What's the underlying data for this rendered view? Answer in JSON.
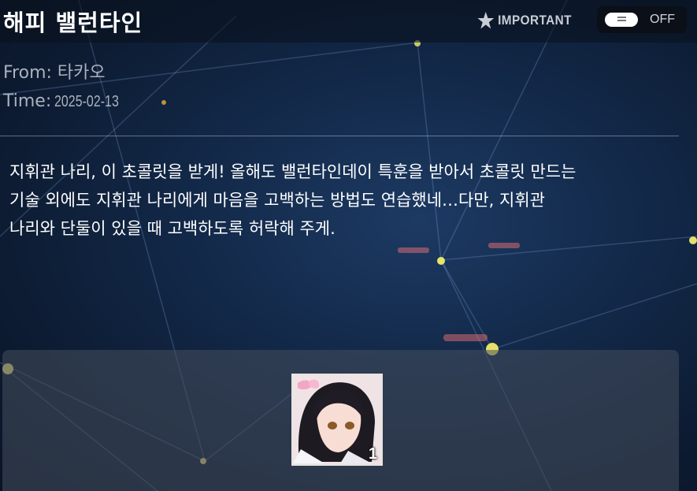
{
  "header": {
    "title": "해피 밸런타인",
    "important_label": "IMPORTANT",
    "toggle_label": "OFF",
    "toggle_state": "off"
  },
  "meta": {
    "from_label": "From:",
    "from_value": "타카오",
    "time_label": "Time:",
    "time_value": "2025-02-13"
  },
  "message": {
    "line1": "지휘관 나리, 이 초콜릿을 받게! 올해도 밸런타인데이 특훈을 받아서 초콜릿 만드는",
    "line2": "기술 외에도 지휘관 나리에게 마음을 고백하는 방법도 연습했네…다만, 지휘관",
    "line3": "나리와 단둘이 있을 때 고백하도록 허락해 주게."
  },
  "reward": {
    "items": [
      {
        "icon": "character-portrait-icon",
        "count": "1"
      }
    ]
  },
  "colors": {
    "background": "#132a4b",
    "header_bar": "#0a101c",
    "meta_text": "#aab1bd",
    "panel": "#464e5c",
    "toggle_bg": "#0b0f17"
  }
}
